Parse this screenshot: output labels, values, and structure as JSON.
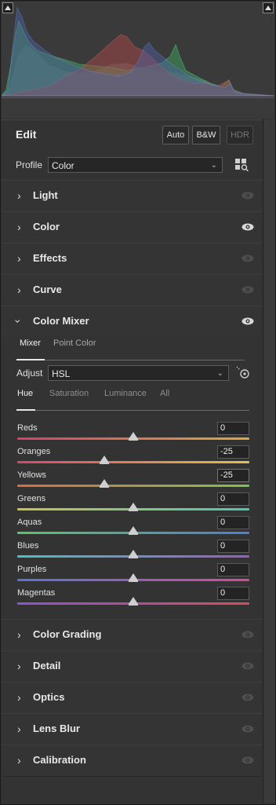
{
  "edit": {
    "title": "Edit",
    "auto": "Auto",
    "bw": "B&W",
    "hdr": "HDR"
  },
  "profile": {
    "label": "Profile",
    "value": "Color"
  },
  "sections_top": [
    {
      "title": "Light",
      "eye_active": false
    },
    {
      "title": "Color",
      "eye_active": true
    },
    {
      "title": "Effects",
      "eye_active": false
    },
    {
      "title": "Curve",
      "eye_active": false
    }
  ],
  "mixer": {
    "title": "Color Mixer",
    "tabs": [
      "Mixer",
      "Point Color"
    ],
    "adjust_label": "Adjust",
    "adjust_value": "HSL",
    "subtabs": [
      "Hue",
      "Saturation",
      "Luminance",
      "All"
    ],
    "sliders": [
      {
        "name": "Reds",
        "value": "0",
        "pos": 0.5,
        "colors": [
          "#d5406a",
          "#d8a843"
        ]
      },
      {
        "name": "Oranges",
        "value": "-25",
        "pos": 0.375,
        "colors": [
          "#d4476a",
          "#e0c04a"
        ]
      },
      {
        "name": "Yellows",
        "value": "-25",
        "pos": 0.375,
        "colors": [
          "#d56b44",
          "#7dc44a"
        ]
      },
      {
        "name": "Greens",
        "value": "0",
        "pos": 0.5,
        "colors": [
          "#c8c447",
          "#48c7b6"
        ]
      },
      {
        "name": "Aquas",
        "value": "0",
        "pos": 0.5,
        "colors": [
          "#5ac56a",
          "#4b7fd2"
        ]
      },
      {
        "name": "Blues",
        "value": "0",
        "pos": 0.5,
        "colors": [
          "#47c3c0",
          "#9b58cc"
        ]
      },
      {
        "name": "Purples",
        "value": "0",
        "pos": 0.5,
        "colors": [
          "#5577d0",
          "#d54a9a"
        ]
      },
      {
        "name": "Magentas",
        "value": "0",
        "pos": 0.5,
        "colors": [
          "#8a55cf",
          "#d94a60"
        ]
      }
    ]
  },
  "sections_bottom": [
    {
      "title": "Color Grading"
    },
    {
      "title": "Detail"
    },
    {
      "title": "Optics"
    },
    {
      "title": "Lens Blur"
    },
    {
      "title": "Calibration"
    }
  ],
  "colors": {
    "accent_blue": "#3d7fd6"
  }
}
